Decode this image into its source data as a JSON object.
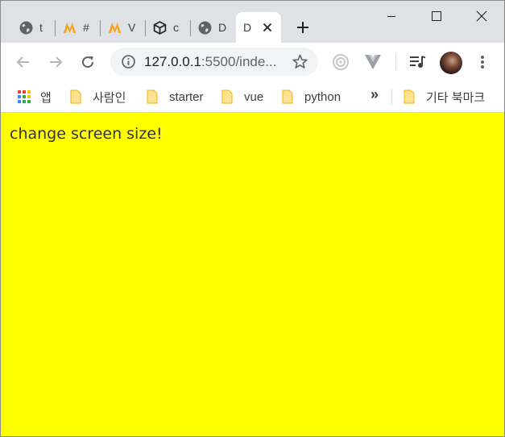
{
  "tabs": [
    {
      "title": "t",
      "icon": "globe-icon"
    },
    {
      "title": "#",
      "icon": "m-logo-icon"
    },
    {
      "title": "V",
      "icon": "m-logo-icon"
    },
    {
      "title": "c",
      "icon": "codesandbox-icon"
    },
    {
      "title": "D",
      "icon": "globe-icon"
    },
    {
      "title": "D",
      "icon": "none",
      "active": true
    }
  ],
  "window_controls": {
    "minimize": "minimize-icon",
    "maximize": "maximize-icon",
    "close": "close-icon"
  },
  "address": {
    "host": "127.0.0.1",
    "port_path": ":5500/inde..."
  },
  "bookmarks": [
    {
      "label": "앱",
      "icon": "apps-grid-icon"
    },
    {
      "label": "사람인",
      "icon": "folder-icon"
    },
    {
      "label": "starter",
      "icon": "folder-icon"
    },
    {
      "label": "vue",
      "icon": "folder-icon"
    },
    {
      "label": "python",
      "icon": "folder-icon"
    }
  ],
  "bookmarks_more": "»",
  "other_bookmarks": "기타 북마크",
  "page": {
    "message": "change screen size!",
    "background": "#ffff00"
  }
}
